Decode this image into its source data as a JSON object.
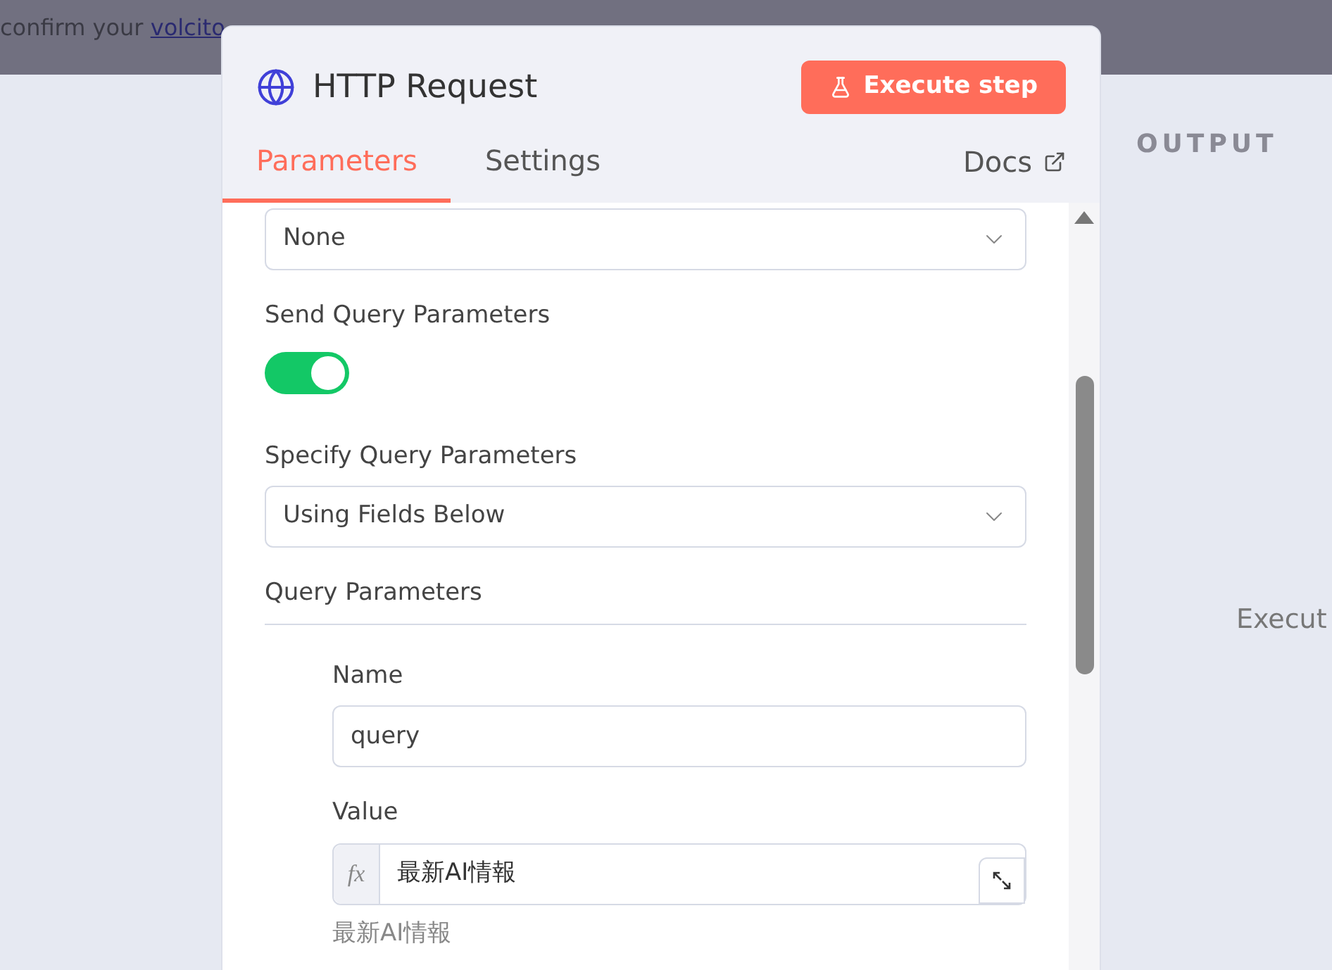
{
  "banner": {
    "text": "confirm your",
    "link": "volcito"
  },
  "output": {
    "title": "OUTPUT",
    "hint": "Execut"
  },
  "node": {
    "title": "HTTP Request",
    "execute_button": "Execute step",
    "tabs": [
      {
        "label": "Parameters",
        "selected": true
      },
      {
        "label": "Settings",
        "selected": false
      }
    ],
    "docs_link": "Docs",
    "fields": [
      {
        "kind": "select",
        "value": "None"
      },
      {
        "kind": "toggle",
        "label": "Send Query Parameters",
        "on": true
      },
      {
        "kind": "select",
        "label": "Specify Query Parameters",
        "value": "Using Fields Below"
      },
      {
        "kind": "section",
        "label": "Query Parameters"
      },
      {
        "kind": "text",
        "label": "Name",
        "value": "query"
      },
      {
        "kind": "expression",
        "label": "Value",
        "badge": "fx",
        "value": "最新AI情報",
        "preview": "最新AI情報"
      }
    ]
  }
}
